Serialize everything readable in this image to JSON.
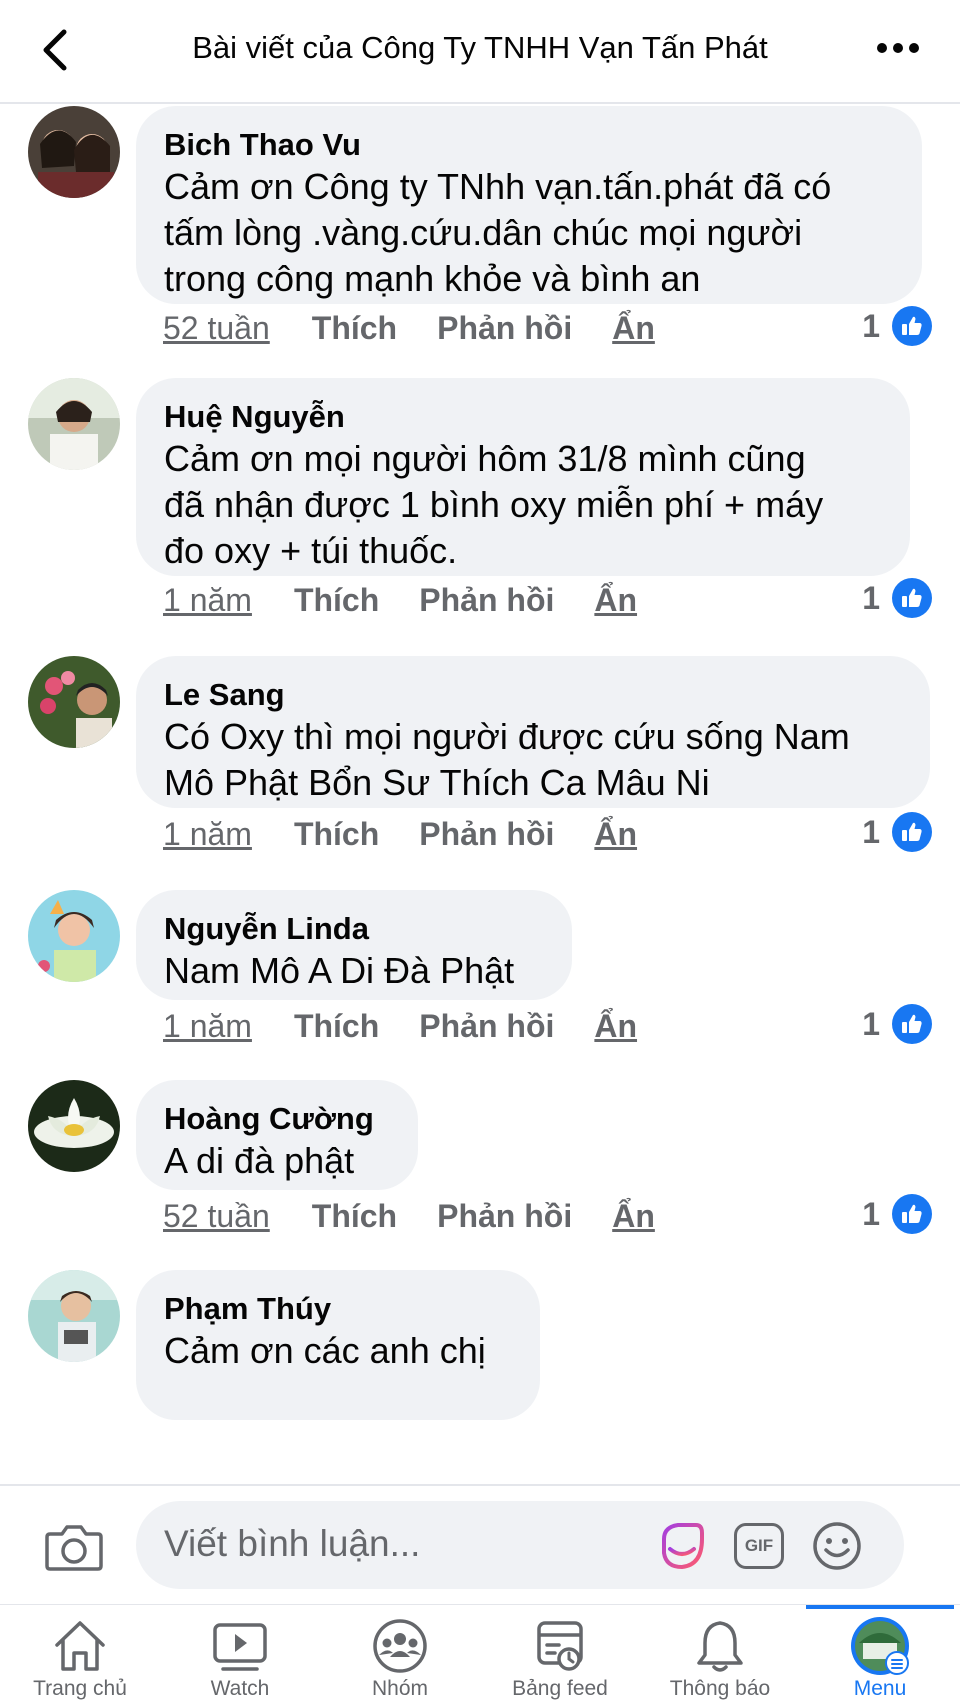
{
  "header": {
    "title": "Bài viết của Công Ty TNHH Vạn Tấn Phát",
    "back_icon": "chevron-left-icon",
    "more_icon": "more-horizontal-icon"
  },
  "actions": {
    "like": "Thích",
    "reply": "Phản hồi",
    "hide": "Ẩn"
  },
  "comments": [
    {
      "author": "Bich Thao Vu",
      "lines": [
        "Cảm ơn Công ty TNhh vạn.tấn.phát đã có",
        "tấm lòng .vàng.cứu.dân chúc mọi người",
        "trong công mạnh khỏe và bình an"
      ],
      "time": "52 tuần",
      "likes": "1"
    },
    {
      "author": "Huệ Nguyễn",
      "lines": [
        "Cảm ơn mọi người hôm 31/8 mình cũng",
        "đã nhận được 1 bình oxy miễn phí  + máy",
        "đo oxy + túi thuốc."
      ],
      "time": "1 năm",
      "likes": "1"
    },
    {
      "author": "Le Sang",
      "lines": [
        "Có Oxy thì mọi người được cứu sống Nam",
        "Mô Phật Bổn Sư Thích Ca Mâu Ni"
      ],
      "time": "1 năm",
      "likes": "1"
    },
    {
      "author": "Nguyễn Linda",
      "lines": [
        "Nam Mô A Di Đà Phật"
      ],
      "time": "1 năm",
      "likes": "1"
    },
    {
      "author": "Hoàng Cường",
      "lines": [
        "A di đà phật"
      ],
      "time": "52 tuần",
      "likes": "1"
    },
    {
      "author": "Phạm Thúy",
      "lines": [
        "Cảm ơn các anh chị"
      ],
      "time": "",
      "likes": ""
    }
  ],
  "composer": {
    "placeholder": "Viết bình luận...",
    "gif_label": "GIF"
  },
  "tabbar": {
    "tabs": [
      {
        "label": "Trang chủ",
        "icon": "home-icon"
      },
      {
        "label": "Watch",
        "icon": "watch-icon"
      },
      {
        "label": "Nhóm",
        "icon": "groups-icon"
      },
      {
        "label": "Bảng feed",
        "icon": "feeds-icon"
      },
      {
        "label": "Thông báo",
        "icon": "bell-icon"
      },
      {
        "label": "Menu",
        "icon": "menu-avatar-icon"
      }
    ],
    "active_index": 5
  },
  "colors": {
    "accent": "#1877f2",
    "bubble": "#f0f2f5",
    "muted": "#65676b"
  }
}
